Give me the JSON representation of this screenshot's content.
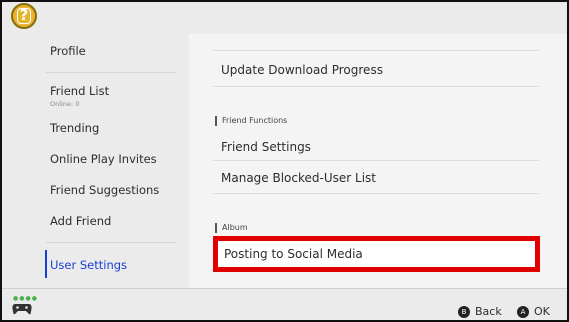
{
  "sidebar": {
    "items": [
      {
        "label": "Profile"
      },
      {
        "label": "Friend List",
        "sub": "Online: 0"
      },
      {
        "label": "Trending"
      },
      {
        "label": "Online Play Invites"
      },
      {
        "label": "Friend Suggestions"
      },
      {
        "label": "Add Friend"
      },
      {
        "label": "User Settings",
        "selected": true
      }
    ]
  },
  "content": {
    "row_update": "Update Download Progress",
    "section_friend": "Friend Functions",
    "row_friend_settings": "Friend Settings",
    "row_blocked": "Manage Blocked-User List",
    "section_album": "Album",
    "row_posting": "Posting to Social Media"
  },
  "footer": {
    "back_glyph": "B",
    "back_label": "Back",
    "ok_glyph": "A",
    "ok_label": "OK",
    "controller_icon": "controller-icon"
  },
  "colors": {
    "accent": "#1a3fd6",
    "highlight": "#e00000"
  }
}
